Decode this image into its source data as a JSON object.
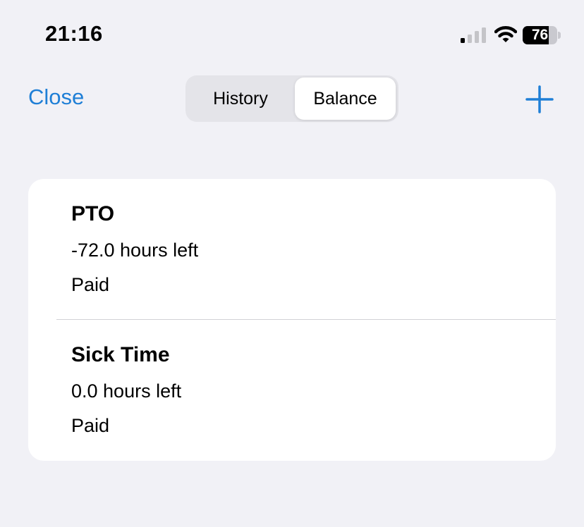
{
  "status_bar": {
    "time": "21:16",
    "battery_level": "76",
    "battery_fraction": 0.76,
    "icons": [
      "signal-icon",
      "wifi-icon",
      "battery-icon"
    ]
  },
  "nav": {
    "close_label": "Close",
    "segments": [
      {
        "label": "History",
        "selected": false
      },
      {
        "label": "Balance",
        "selected": true
      }
    ],
    "add_icon": "plus-icon",
    "accent_color": "#1f7fd6"
  },
  "balances": [
    {
      "title": "PTO",
      "hours": "-72.0 hours left",
      "type": "Paid"
    },
    {
      "title": "Sick Time",
      "hours": "0.0 hours left",
      "type": "Paid"
    }
  ]
}
